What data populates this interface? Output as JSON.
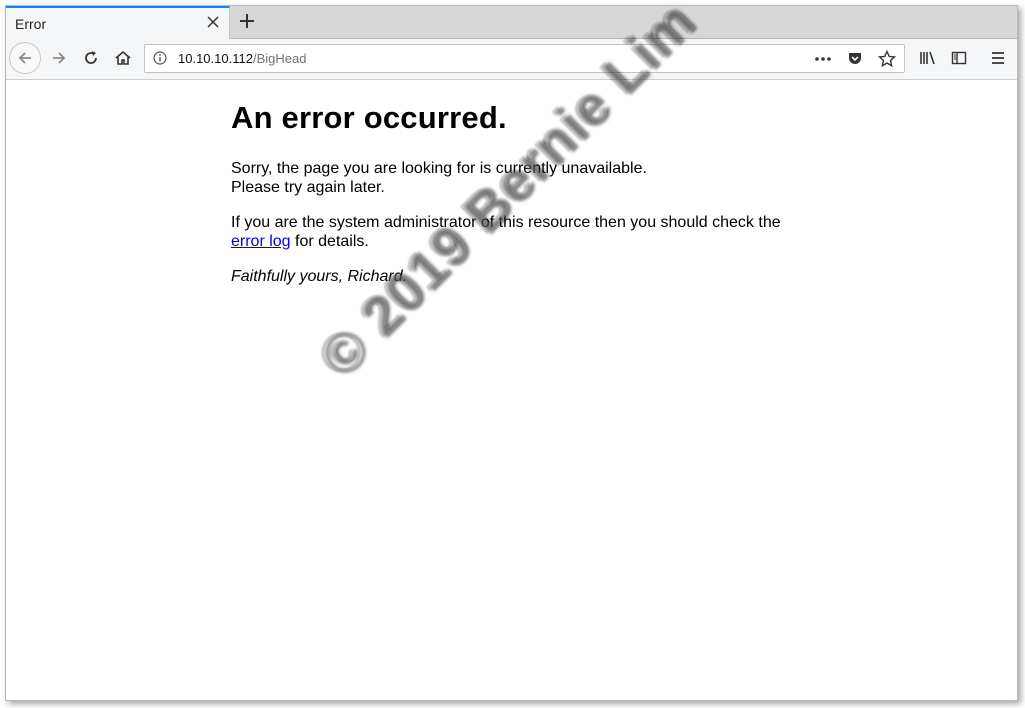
{
  "browser": {
    "tab": {
      "title": "Error"
    },
    "url": {
      "host": "10.10.10.112",
      "path": "/BigHead"
    }
  },
  "icons": {
    "tab_close": "close-icon",
    "new_tab": "plus-icon",
    "back": "arrow-left-icon",
    "forward": "arrow-right-icon",
    "reload": "reload-icon",
    "home": "home-icon",
    "site_info": "info-icon",
    "page_actions": "more-horizontal-icon",
    "pocket": "pocket-icon",
    "bookmark": "star-icon",
    "library": "library-icon",
    "sidebar": "sidebar-icon",
    "menu": "hamburger-menu-icon"
  },
  "page": {
    "heading": "An error occurred.",
    "para1_line1": "Sorry, the page you are looking for is currently unavailable.",
    "para1_line2": "Please try again later.",
    "para2_text": "If you are the system administrator of this resource then you should check the",
    "para2_link": "error log",
    "para2_suffix": " for details.",
    "signature": "Faithfully yours, Richard."
  },
  "watermark": "© 2019 Bernie Lim",
  "colors": {
    "tab_accent": "#0a84ff",
    "link": "#0000ee",
    "chrome_bg": "#f5f6f7",
    "tabstrip_bg": "#d7d7d8"
  }
}
